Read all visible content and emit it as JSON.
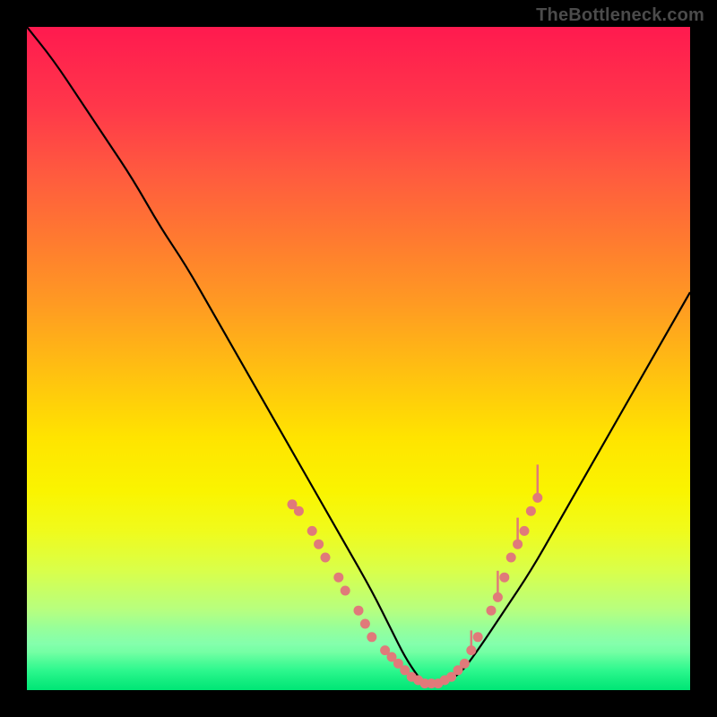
{
  "watermark": "TheBottleneck.com",
  "chart_data": {
    "type": "line",
    "title": "",
    "xlabel": "",
    "ylabel": "",
    "xlim": [
      0,
      100
    ],
    "ylim": [
      0,
      100
    ],
    "background_gradient": {
      "top": "#ff1a4f",
      "upper_mid": "#ff9b22",
      "mid": "#ffe400",
      "lower_mid": "#d9ff4a",
      "bottom": "#00e676"
    },
    "series": [
      {
        "name": "curve",
        "x": [
          0,
          4,
          8,
          12,
          16,
          20,
          24,
          28,
          32,
          36,
          40,
          44,
          48,
          52,
          55,
          57,
          59,
          60,
          62,
          65,
          68,
          72,
          76,
          80,
          84,
          88,
          92,
          96,
          100
        ],
        "y": [
          100,
          95,
          89,
          83,
          77,
          70,
          64,
          57,
          50,
          43,
          36,
          29,
          22,
          15,
          9,
          5,
          2,
          1,
          1,
          2,
          6,
          12,
          18,
          25,
          32,
          39,
          46,
          53,
          60
        ]
      }
    ],
    "markers": {
      "name": "highlight-dots",
      "color": "#e07a7a",
      "points": [
        {
          "x": 40,
          "y": 28
        },
        {
          "x": 41,
          "y": 27
        },
        {
          "x": 43,
          "y": 24
        },
        {
          "x": 44,
          "y": 22
        },
        {
          "x": 45,
          "y": 20
        },
        {
          "x": 47,
          "y": 17
        },
        {
          "x": 48,
          "y": 15
        },
        {
          "x": 50,
          "y": 12
        },
        {
          "x": 51,
          "y": 10
        },
        {
          "x": 52,
          "y": 8
        },
        {
          "x": 54,
          "y": 6
        },
        {
          "x": 55,
          "y": 5
        },
        {
          "x": 56,
          "y": 4
        },
        {
          "x": 57,
          "y": 3
        },
        {
          "x": 58,
          "y": 2
        },
        {
          "x": 59,
          "y": 1.5
        },
        {
          "x": 60,
          "y": 1
        },
        {
          "x": 61,
          "y": 1
        },
        {
          "x": 62,
          "y": 1
        },
        {
          "x": 63,
          "y": 1.5
        },
        {
          "x": 64,
          "y": 2
        },
        {
          "x": 65,
          "y": 3
        },
        {
          "x": 66,
          "y": 4
        },
        {
          "x": 67,
          "y": 6
        },
        {
          "x": 68,
          "y": 8
        },
        {
          "x": 70,
          "y": 12
        },
        {
          "x": 71,
          "y": 14
        },
        {
          "x": 72,
          "y": 17
        },
        {
          "x": 73,
          "y": 20
        },
        {
          "x": 74,
          "y": 22
        },
        {
          "x": 75,
          "y": 24
        },
        {
          "x": 76,
          "y": 27
        },
        {
          "x": 77,
          "y": 29
        }
      ],
      "spikes": [
        {
          "x": 67,
          "y": 6,
          "len": 3
        },
        {
          "x": 71,
          "y": 14,
          "len": 4
        },
        {
          "x": 74,
          "y": 22,
          "len": 4
        },
        {
          "x": 77,
          "y": 29,
          "len": 5
        }
      ]
    }
  }
}
